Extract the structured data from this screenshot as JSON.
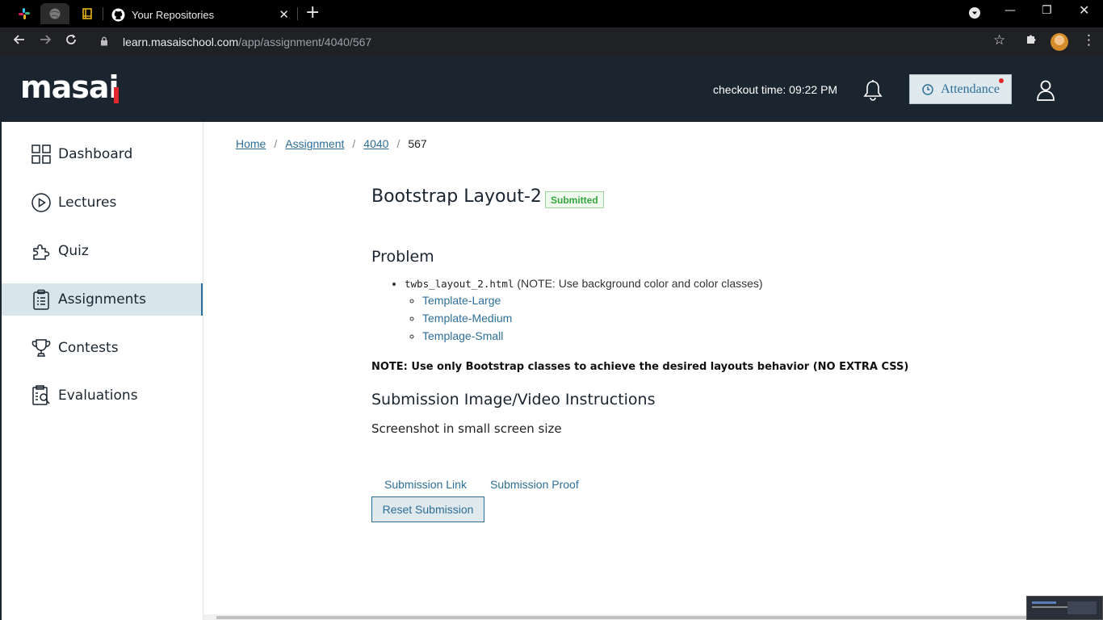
{
  "browser": {
    "tabs": [
      {
        "title": "Your Repositories"
      }
    ],
    "url_host": "learn.masaischool.com",
    "url_path": "/app/assignment/4040/567"
  },
  "header": {
    "logo": "masai",
    "checkout_time": "checkout time: 09:22 PM",
    "attendance_label": "Attendance"
  },
  "sidebar": {
    "items": [
      {
        "label": "Dashboard"
      },
      {
        "label": "Lectures"
      },
      {
        "label": "Quiz"
      },
      {
        "label": "Assignments",
        "active": true
      },
      {
        "label": "Contests"
      },
      {
        "label": "Evaluations"
      }
    ]
  },
  "breadcrumb": {
    "home": "Home",
    "assignment": "Assignment",
    "id": "4040",
    "current": "567",
    "separator": "/"
  },
  "assignment": {
    "title": "Bootstrap Layout-2",
    "status": "Submitted",
    "problem_heading": "Problem",
    "file_name": "twbs_layout_2.html",
    "file_note": "(NOTE: Use background color and color classes)",
    "templates": [
      "Template-Large",
      "Template-Medium",
      "Templage-Small"
    ],
    "note": "NOTE: Use only Bootstrap classes to achieve the desired layouts behavior (NO EXTRA CSS)",
    "submission_heading": "Submission Image/Video Instructions",
    "submission_text": "Screenshot in small screen size",
    "submission_link": "Submission Link",
    "submission_proof": "Submission Proof",
    "reset_label": "Reset Submission"
  },
  "colors": {
    "header_bg": "#1b2530",
    "accent": "#2d6e97",
    "active_bg": "#d8e6ec",
    "status_green": "#34a53c",
    "logo_red": "#e1262d"
  }
}
